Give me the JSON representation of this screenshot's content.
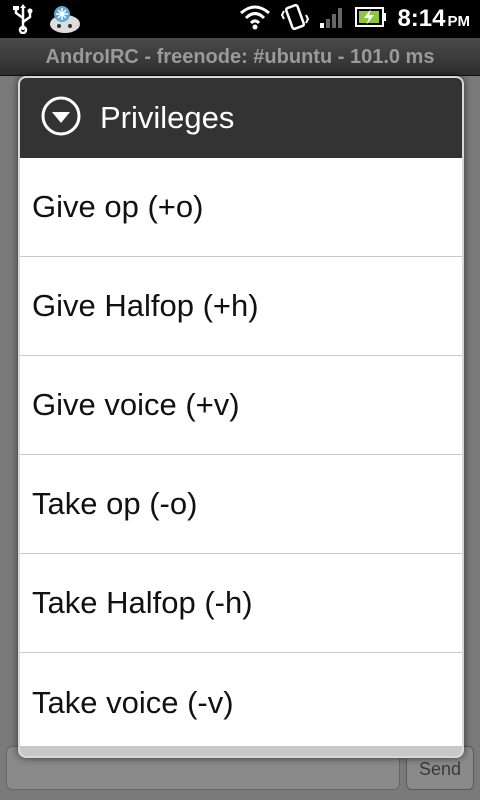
{
  "status_bar": {
    "time": "8:14",
    "ampm": "PM",
    "icons": [
      "usb-icon",
      "android-icon",
      "wifi-icon",
      "vibrate-icon",
      "signal-icon",
      "battery-charging-icon"
    ]
  },
  "title_bar": {
    "title": "AndroIRC - freenode: #ubuntu - 101.0 ms"
  },
  "background": {
    "send_label": "Send"
  },
  "dialog": {
    "title": "Privileges",
    "icon": "chevron-down-circle-icon",
    "items": [
      {
        "label": "Give op (+o)"
      },
      {
        "label": "Give Halfop (+h)"
      },
      {
        "label": "Give voice (+v)"
      },
      {
        "label": "Take op (-o)"
      },
      {
        "label": "Take Halfop (-h)"
      },
      {
        "label": "Take voice (-v)"
      }
    ]
  }
}
